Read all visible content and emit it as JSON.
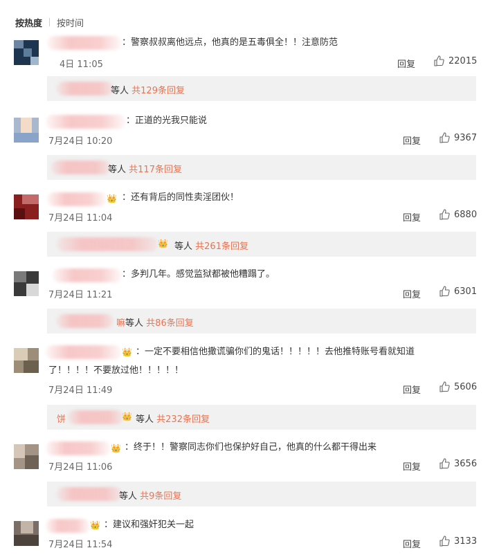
{
  "sort": {
    "hot": "按热度",
    "time": "按时间"
  },
  "reply_label": "回复",
  "others_suffix": "等人",
  "colors": {
    "accent": "#eb7350",
    "badge": "#e6a23c"
  },
  "comments": [
    {
      "text": "：警察叔叔离他远点，他真的是五毒俱全！！注意防范",
      "time": "4日 11:05",
      "likes": "22015",
      "sub_prefix": "",
      "sub_count": "共129条回复"
    },
    {
      "text": "：正道的光我只能说",
      "time": "7月24日 10:20",
      "likes": "9367",
      "sub_prefix": "",
      "sub_count": "共117条回复"
    },
    {
      "text": "：还有背后的同性卖淫团伙！",
      "time": "7月24日 11:04",
      "likes": "6880",
      "sub_prefix": "",
      "sub_count": "共261条回复"
    },
    {
      "text": "：多判几年。感觉监狱都被他糟蹋了。",
      "time": "7月24日 11:21",
      "likes": "6301",
      "sub_prefix": "嘛",
      "sub_count": "共86条回复"
    },
    {
      "text": "：一定不要相信他撒谎骗你们的鬼话！！！！！去他推特账号看就知道",
      "text2": "了！！！！不要放过他！！！！！",
      "time": "7月24日 11:49",
      "likes": "5606",
      "sub_prefix": "饼",
      "sub_count": "共232条回复"
    },
    {
      "text": "：终于！！警察同志你们也保护好自己，他真的什么都干得出来",
      "time": "7月24日 11:06",
      "likes": "3656",
      "sub_prefix": "",
      "sub_count": "共9条回复"
    },
    {
      "text": "：建议和强奸犯关一起",
      "time": "7月24日 11:54",
      "likes": "3133",
      "sub_prefix": "",
      "sub_count": ""
    }
  ]
}
